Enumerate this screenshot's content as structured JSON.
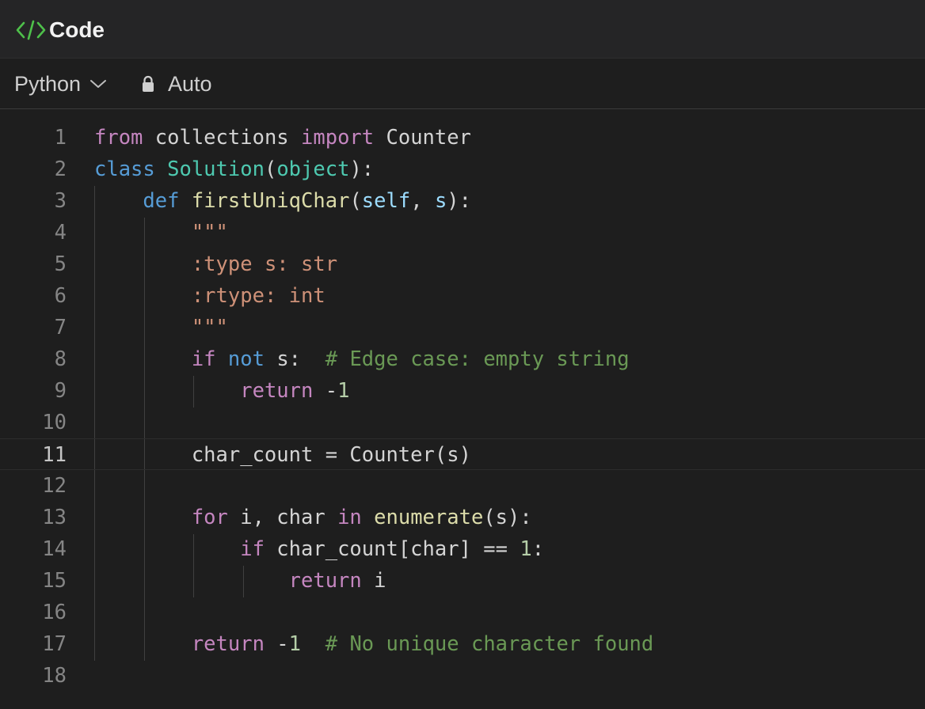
{
  "header": {
    "title": "Code",
    "icon": "code-brackets-icon",
    "accent": "#4ec04a"
  },
  "toolbar": {
    "language": "Python",
    "mode": "Auto"
  },
  "editor": {
    "active_line": 11,
    "lines": [
      {
        "n": "1",
        "tokens": [
          {
            "t": "from",
            "c": "kw-ctrl"
          },
          {
            "t": " collections ",
            "c": "plain"
          },
          {
            "t": "import",
            "c": "kw-ctrl"
          },
          {
            "t": " Counter",
            "c": "plain"
          }
        ]
      },
      {
        "n": "2",
        "tokens": [
          {
            "t": "class",
            "c": "kw"
          },
          {
            "t": " ",
            "c": "plain"
          },
          {
            "t": "Solution",
            "c": "cls"
          },
          {
            "t": "(",
            "c": "plain"
          },
          {
            "t": "object",
            "c": "cls"
          },
          {
            "t": "):",
            "c": "plain"
          }
        ]
      },
      {
        "n": "3",
        "tokens": [
          {
            "t": "    ",
            "c": "plain"
          },
          {
            "t": "def",
            "c": "kw"
          },
          {
            "t": " ",
            "c": "plain"
          },
          {
            "t": "firstUniqChar",
            "c": "fn"
          },
          {
            "t": "(",
            "c": "plain"
          },
          {
            "t": "self",
            "c": "param"
          },
          {
            "t": ", ",
            "c": "plain"
          },
          {
            "t": "s",
            "c": "param"
          },
          {
            "t": "):",
            "c": "plain"
          }
        ]
      },
      {
        "n": "4",
        "tokens": [
          {
            "t": "        ",
            "c": "plain"
          },
          {
            "t": "\"\"\"",
            "c": "str"
          }
        ]
      },
      {
        "n": "5",
        "tokens": [
          {
            "t": "        ",
            "c": "plain"
          },
          {
            "t": ":type s: str",
            "c": "str"
          }
        ]
      },
      {
        "n": "6",
        "tokens": [
          {
            "t": "        ",
            "c": "plain"
          },
          {
            "t": ":rtype: int",
            "c": "str"
          }
        ]
      },
      {
        "n": "7",
        "tokens": [
          {
            "t": "        ",
            "c": "plain"
          },
          {
            "t": "\"\"\"",
            "c": "str"
          }
        ]
      },
      {
        "n": "8",
        "tokens": [
          {
            "t": "        ",
            "c": "plain"
          },
          {
            "t": "if",
            "c": "kw-ctrl"
          },
          {
            "t": " ",
            "c": "plain"
          },
          {
            "t": "not",
            "c": "kw"
          },
          {
            "t": " s:  ",
            "c": "plain"
          },
          {
            "t": "# Edge case: empty string",
            "c": "cmt"
          }
        ]
      },
      {
        "n": "9",
        "tokens": [
          {
            "t": "            ",
            "c": "plain"
          },
          {
            "t": "return",
            "c": "kw-ctrl"
          },
          {
            "t": " -",
            "c": "plain"
          },
          {
            "t": "1",
            "c": "num"
          }
        ]
      },
      {
        "n": "10",
        "tokens": []
      },
      {
        "n": "11",
        "tokens": [
          {
            "t": "        char_count = Counter(s)",
            "c": "plain"
          }
        ]
      },
      {
        "n": "12",
        "tokens": []
      },
      {
        "n": "13",
        "tokens": [
          {
            "t": "        ",
            "c": "plain"
          },
          {
            "t": "for",
            "c": "kw-ctrl"
          },
          {
            "t": " i, char ",
            "c": "plain"
          },
          {
            "t": "in",
            "c": "kw-ctrl"
          },
          {
            "t": " ",
            "c": "plain"
          },
          {
            "t": "enumerate",
            "c": "fn"
          },
          {
            "t": "(s):",
            "c": "plain"
          }
        ]
      },
      {
        "n": "14",
        "tokens": [
          {
            "t": "            ",
            "c": "plain"
          },
          {
            "t": "if",
            "c": "kw-ctrl"
          },
          {
            "t": " char_count[char] == ",
            "c": "plain"
          },
          {
            "t": "1",
            "c": "num"
          },
          {
            "t": ":",
            "c": "plain"
          }
        ]
      },
      {
        "n": "15",
        "tokens": [
          {
            "t": "                ",
            "c": "plain"
          },
          {
            "t": "return",
            "c": "kw-ctrl"
          },
          {
            "t": " i",
            "c": "plain"
          }
        ]
      },
      {
        "n": "16",
        "tokens": []
      },
      {
        "n": "17",
        "tokens": [
          {
            "t": "        ",
            "c": "plain"
          },
          {
            "t": "return",
            "c": "kw-ctrl"
          },
          {
            "t": " -",
            "c": "plain"
          },
          {
            "t": "1",
            "c": "num"
          },
          {
            "t": "  ",
            "c": "plain"
          },
          {
            "t": "# No unique character found",
            "c": "cmt"
          }
        ]
      },
      {
        "n": "18",
        "tokens": []
      }
    ]
  }
}
